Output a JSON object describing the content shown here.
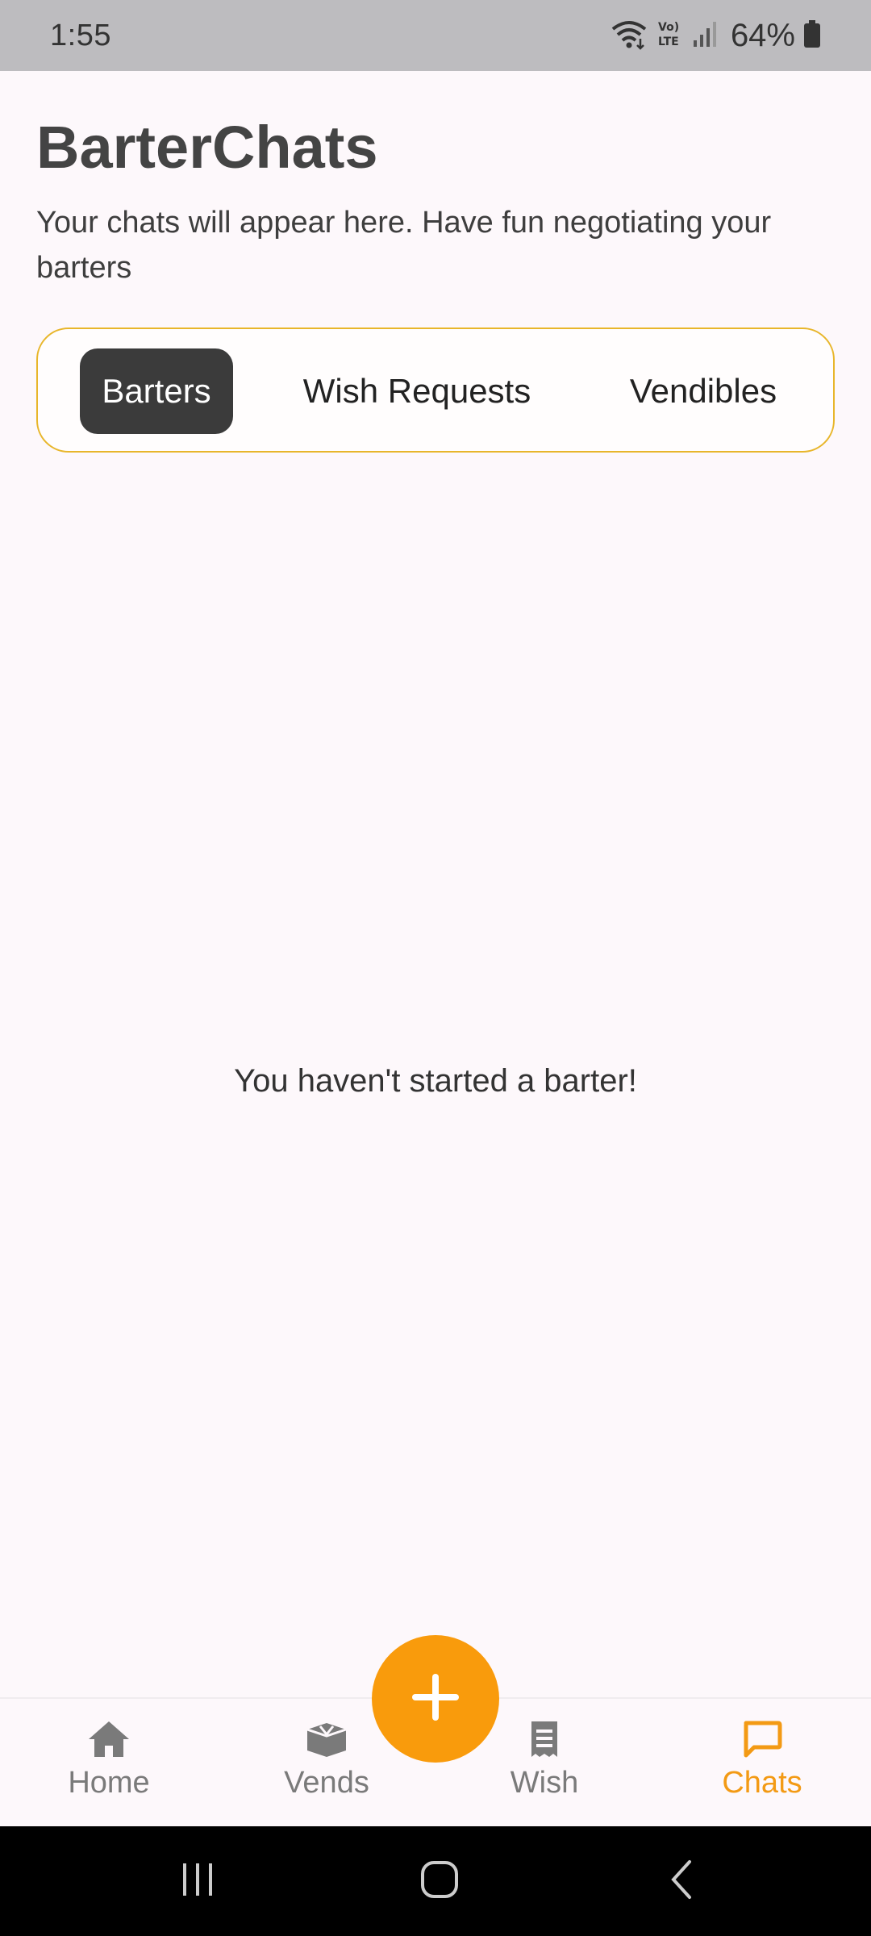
{
  "status_bar": {
    "time": "1:55",
    "battery": "64%",
    "icons": [
      "wifi-icon",
      "volte-icon",
      "signal-icon",
      "battery-icon"
    ]
  },
  "header": {
    "title": "BarterChats",
    "subtitle": "Your chats will appear here. Have fun negotiating your barters"
  },
  "tabs": {
    "items": [
      {
        "label": "Barters",
        "active": true
      },
      {
        "label": "Wish Requests",
        "active": false
      },
      {
        "label": "Vendibles",
        "active": false
      }
    ]
  },
  "main": {
    "empty_message": "You haven't started a barter!"
  },
  "bottom_nav": {
    "items": [
      {
        "label": "Home",
        "icon": "home-icon"
      },
      {
        "label": "Vends",
        "icon": "box-icon"
      },
      {
        "label": "Wish",
        "icon": "receipt-icon"
      },
      {
        "label": "Chats",
        "icon": "chat-bubble-icon",
        "active": true
      }
    ],
    "fab_icon": "plus-icon"
  },
  "colors": {
    "accent": "#f99b0c",
    "tab_border": "#e8b62b",
    "active_tab": "#3b3b3b",
    "background": "#fdf8fb"
  }
}
